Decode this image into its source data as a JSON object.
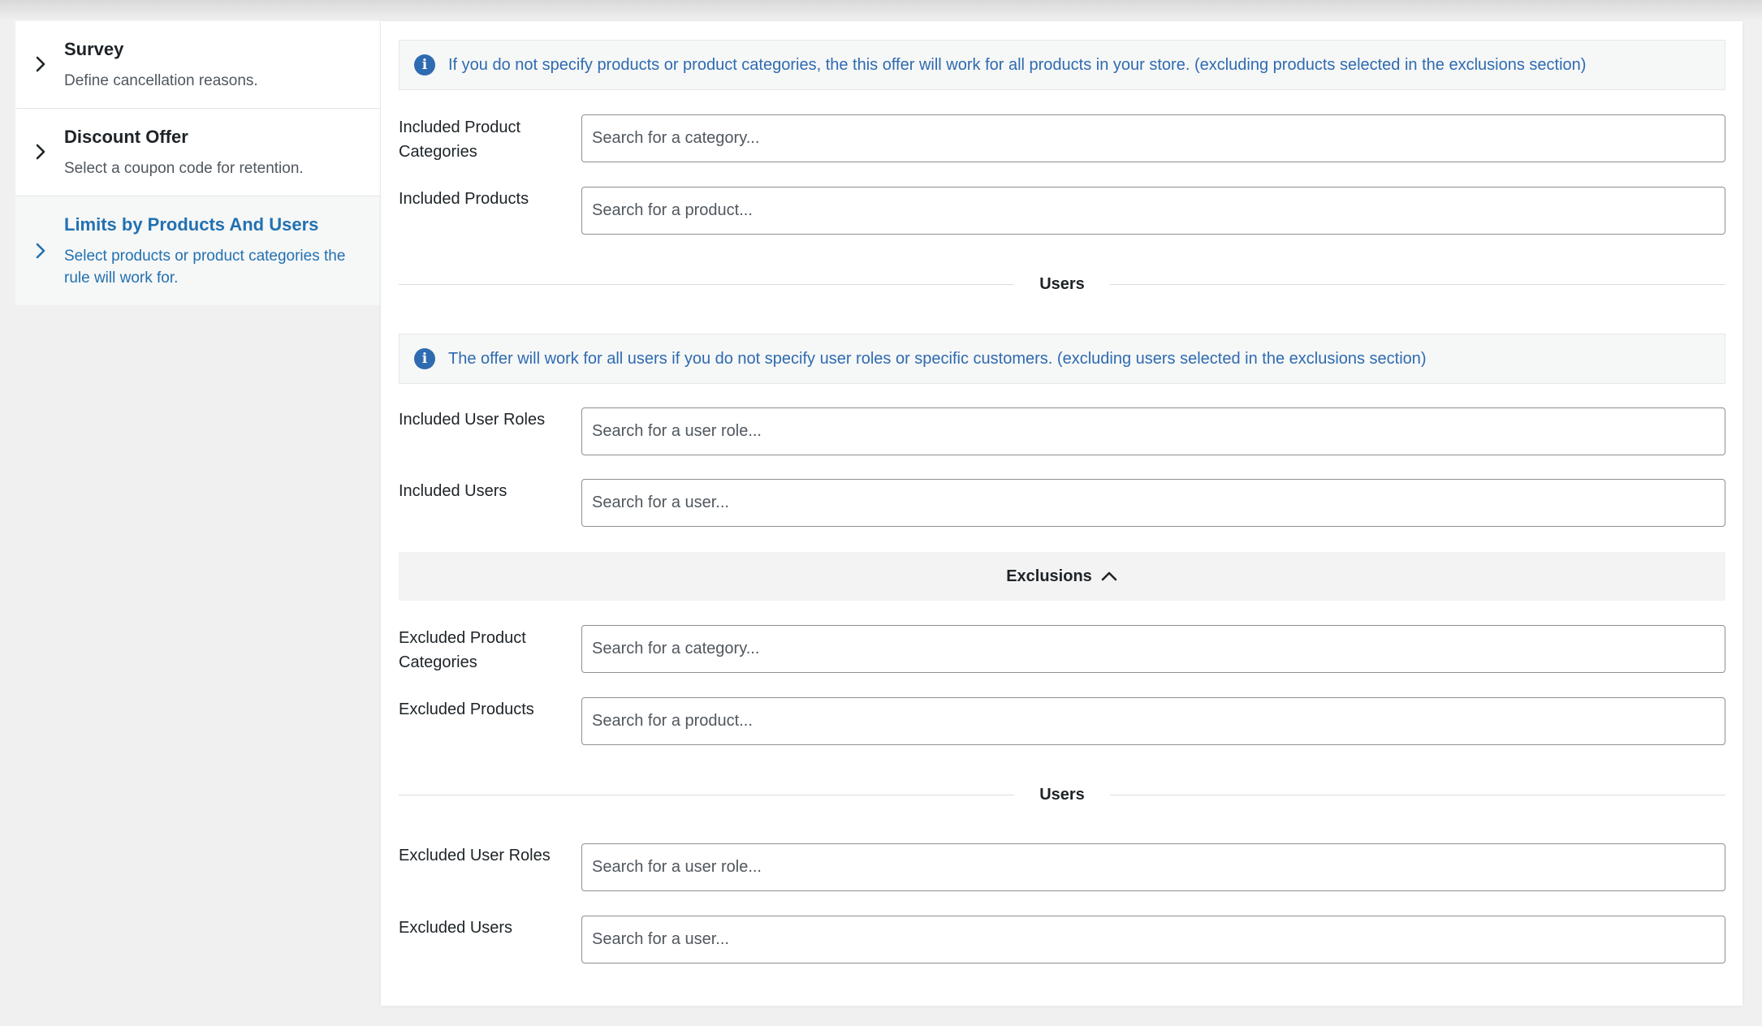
{
  "sidebar": {
    "items": [
      {
        "title": "Survey",
        "description": "Define cancellation reasons."
      },
      {
        "title": "Discount Offer",
        "description": "Select a coupon code for retention."
      },
      {
        "title": "Limits by Products And Users",
        "description": "Select products or product categories the rule will work for."
      }
    ]
  },
  "main": {
    "products_notice": "If you do not specify products or product categories, the this offer will work for all products in your store. (excluding products selected in the exclusions section)",
    "included_categories": {
      "label": "Included Product Categories",
      "placeholder": "Search for a category..."
    },
    "included_products": {
      "label": "Included Products",
      "placeholder": "Search for a product..."
    },
    "users_divider": "Users",
    "users_notice": "The offer will work for all users if you do not specify user roles or specific customers. (excluding users selected in the exclusions section)",
    "included_user_roles": {
      "label": "Included User Roles",
      "placeholder": "Search for a user role..."
    },
    "included_users": {
      "label": "Included Users",
      "placeholder": "Search for a user..."
    },
    "exclusions_toggle": "Exclusions",
    "excluded_categories": {
      "label": "Excluded Product Categories",
      "placeholder": "Search for a category..."
    },
    "excluded_products": {
      "label": "Excluded Products",
      "placeholder": "Search for a product..."
    },
    "excluded_users_divider": "Users",
    "excluded_user_roles": {
      "label": "Excluded User Roles",
      "placeholder": "Search for a user role..."
    },
    "excluded_users": {
      "label": "Excluded Users",
      "placeholder": "Search for a user..."
    }
  },
  "colors": {
    "accent": "#2271b1",
    "info": "#2e6bb0",
    "text": "#1d2327",
    "muted": "#50575e",
    "page_bg": "#f0f0f1"
  },
  "icons": {
    "sidebar_chevron": "chevron-right-icon",
    "notice_icon": "info-icon",
    "exclusions_chevron": "chevron-up-icon"
  }
}
